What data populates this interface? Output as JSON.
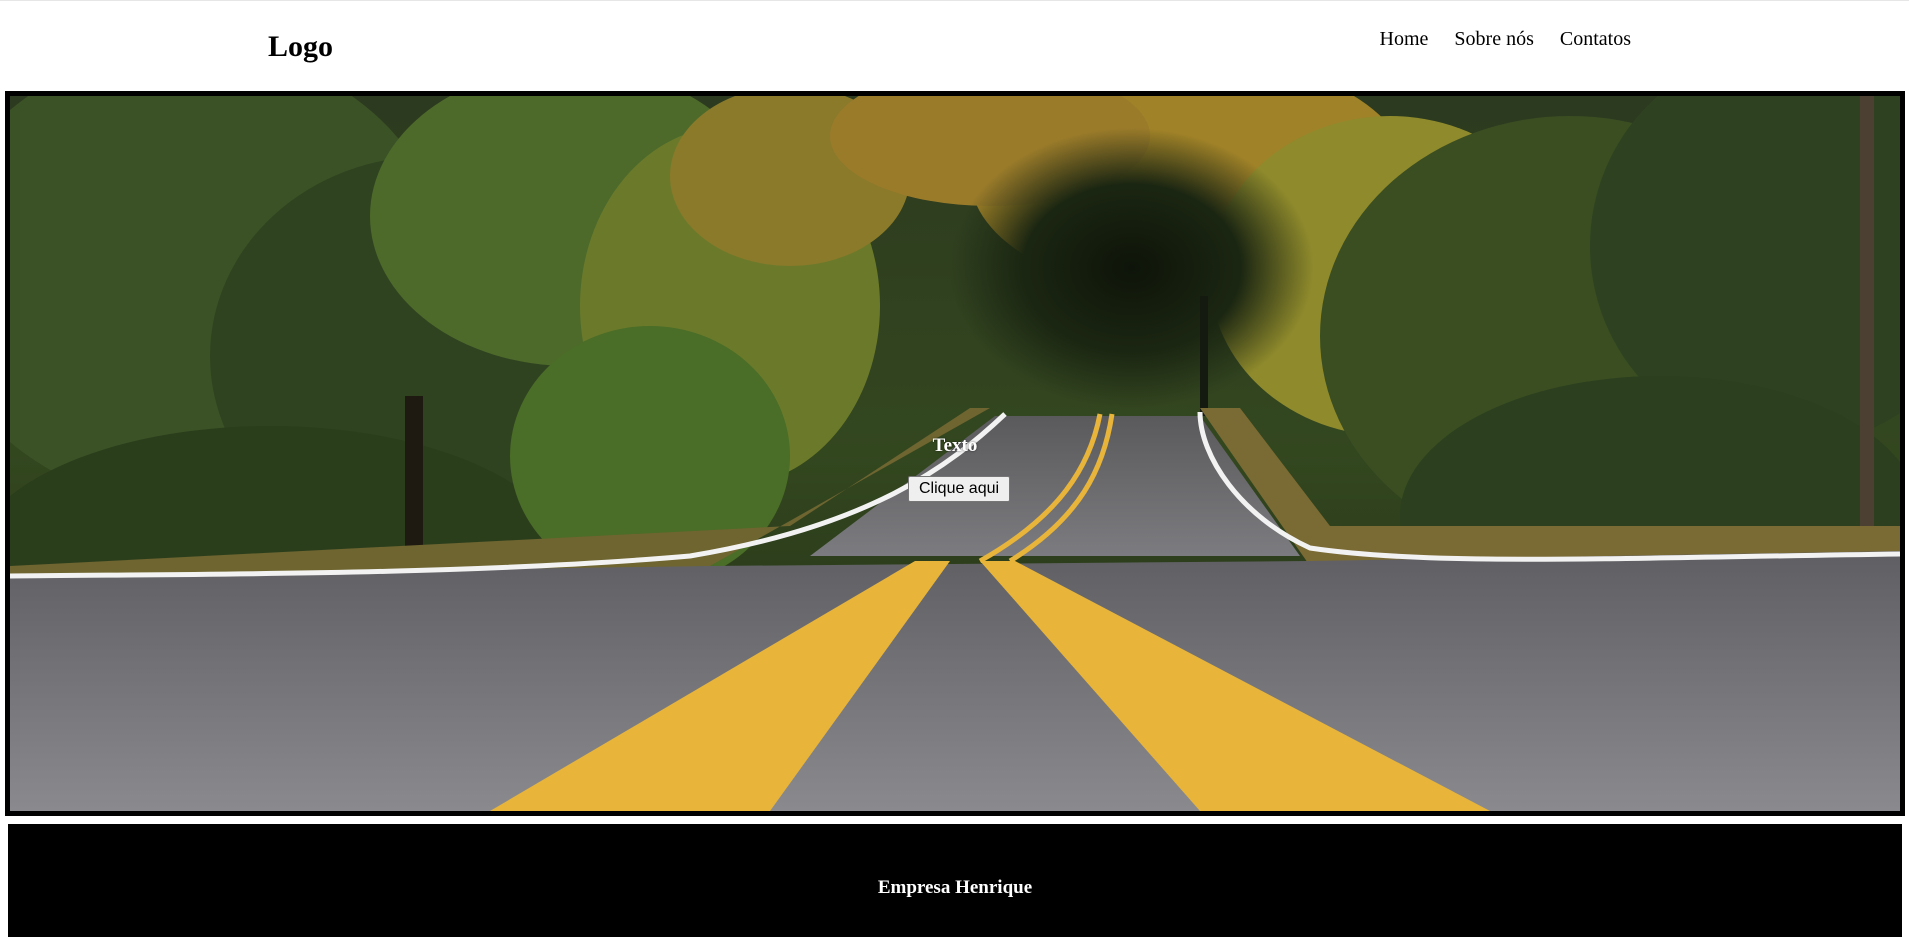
{
  "header": {
    "logo": "Logo",
    "nav": [
      {
        "label": "Home"
      },
      {
        "label": "Sobre nós"
      },
      {
        "label": "Contatos"
      }
    ]
  },
  "hero": {
    "image": "forest-road-photo",
    "text": "Texto",
    "button_label": "Clique aqui"
  },
  "footer": {
    "text": "Empresa Henrique"
  },
  "colors": {
    "footer_bg": "#000000",
    "hero_border": "#000000",
    "road_line_yellow": "#e8b43a",
    "road_line_white": "#f2f2f2"
  }
}
